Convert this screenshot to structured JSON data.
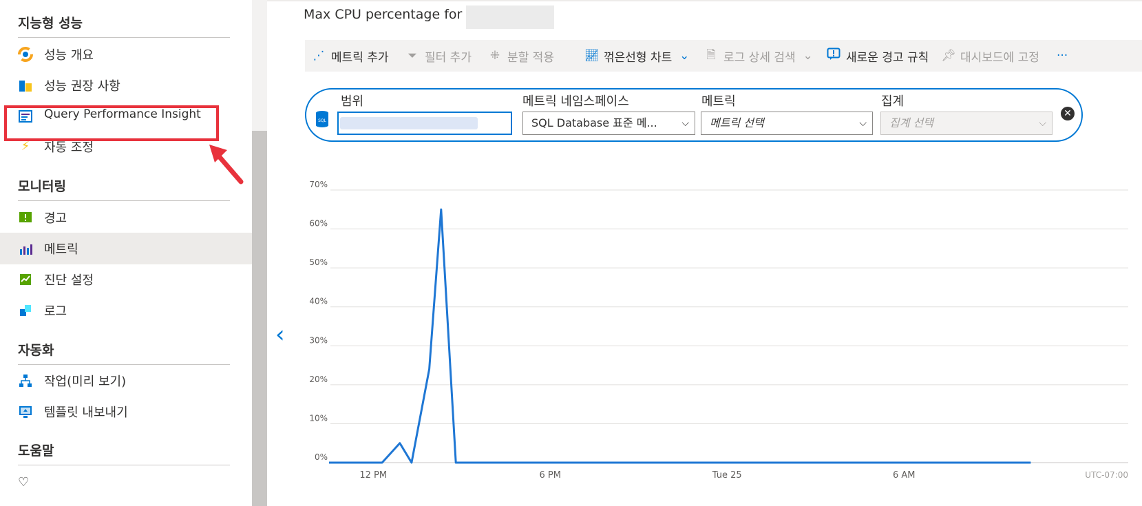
{
  "sidebar": {
    "sections": [
      {
        "title": "지능형 성능",
        "items": [
          {
            "label": "성능 개요",
            "icon": "performance-overview-icon"
          },
          {
            "label": "성능 권장 사항",
            "icon": "recommendations-icon"
          },
          {
            "label": "Query Performance Insight",
            "icon": "query-insight-icon"
          },
          {
            "label": "자동 조정",
            "icon": "lightning-icon"
          }
        ]
      },
      {
        "title": "모니터링",
        "items": [
          {
            "label": "경고",
            "icon": "alert-icon"
          },
          {
            "label": "메트릭",
            "icon": "metrics-icon"
          },
          {
            "label": "진단 설정",
            "icon": "diagnostic-icon"
          },
          {
            "label": "로그",
            "icon": "logs-icon"
          }
        ]
      },
      {
        "title": "자동화",
        "items": [
          {
            "label": "작업(미리 보기)",
            "icon": "tasks-icon"
          },
          {
            "label": "템플릿 내보내기",
            "icon": "export-template-icon"
          }
        ]
      },
      {
        "title": "도움말",
        "items": []
      }
    ]
  },
  "main": {
    "chart_title": "Max CPU percentage for",
    "toolbar": {
      "add_metric": "메트릭 추가",
      "add_filter": "필터 추가",
      "apply_split": "분할 적용",
      "line_chart": "꺾은선형 차트",
      "log_search": "로그 상세 검색",
      "new_alert": "새로운 경고 규칙",
      "pin_dashboard": "대시보드에 고정",
      "more": "···"
    },
    "metric_row": {
      "scope_label": "범위",
      "namespace_label": "메트릭 네임스페이스",
      "namespace_value": "SQL Database 표준 메...",
      "metric_label": "메트릭",
      "metric_placeholder": "메트릭 선택",
      "aggregation_label": "집계",
      "aggregation_placeholder": "집계 선택",
      "sql_badge": "SQL"
    }
  },
  "chart_data": {
    "type": "line",
    "y_ticks": [
      "0%",
      "10%",
      "20%",
      "30%",
      "40%",
      "50%",
      "60%",
      "70%"
    ],
    "ylim": [
      0,
      70
    ],
    "x_ticks": [
      "12 PM",
      "6 PM",
      "Tue 25",
      "6 AM"
    ],
    "timezone": "UTC-07:00",
    "xlim_hours": [
      -1.5,
      22.5
    ],
    "series": [
      {
        "color": "#1f77d4",
        "points": [
          [
            -1.5,
            0
          ],
          [
            0.3,
            0
          ],
          [
            0.9,
            5
          ],
          [
            1.3,
            0
          ],
          [
            1.9,
            24
          ],
          [
            2.3,
            65
          ],
          [
            2.8,
            0
          ],
          [
            22.3,
            0
          ]
        ]
      }
    ],
    "grid": true
  }
}
